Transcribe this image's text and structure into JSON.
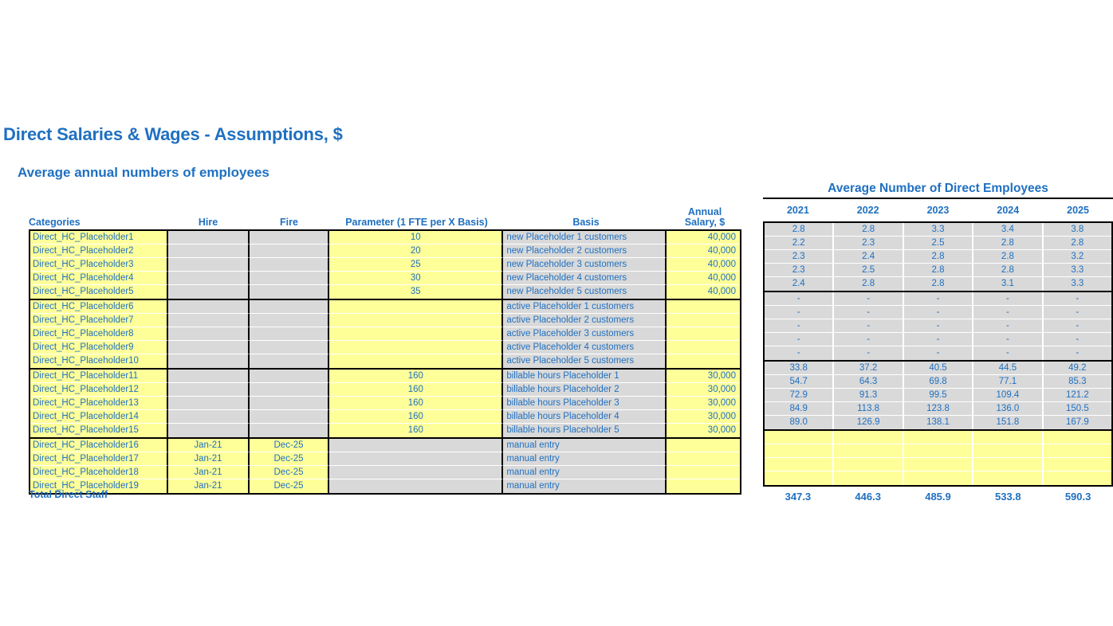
{
  "page": {
    "title": "Direct Salaries & Wages - Assumptions, $",
    "section_title": "Average annual numbers of employees",
    "total_label": "Total Direct Staff"
  },
  "colors": {
    "accent_blue": "#1F70C1",
    "input_yellow": "#FFFF99",
    "formula_gray": "#D9D9D9",
    "border_black": "#000000"
  },
  "left_table": {
    "headers": {
      "categories": "Categories",
      "hire": "Hire",
      "fire": "Fire",
      "parameter": "Parameter (1 FTE per X Basis)",
      "basis": "Basis",
      "annual_salary_line1": "Annual",
      "annual_salary_line2": "Salary, $"
    },
    "groups": [
      {
        "rows": [
          {
            "category": "Direct_HC_Placeholder1",
            "hire": "",
            "fire": "",
            "parameter": "10",
            "basis": "new Placeholder 1 customers",
            "salary": "40,000"
          },
          {
            "category": "Direct_HC_Placeholder2",
            "hire": "",
            "fire": "",
            "parameter": "20",
            "basis": "new Placeholder 2 customers",
            "salary": "40,000"
          },
          {
            "category": "Direct_HC_Placeholder3",
            "hire": "",
            "fire": "",
            "parameter": "25",
            "basis": "new Placeholder 3 customers",
            "salary": "40,000"
          },
          {
            "category": "Direct_HC_Placeholder4",
            "hire": "",
            "fire": "",
            "parameter": "30",
            "basis": "new Placeholder 4 customers",
            "salary": "40,000"
          },
          {
            "category": "Direct_HC_Placeholder5",
            "hire": "",
            "fire": "",
            "parameter": "35",
            "basis": "new Placeholder 5 customers",
            "salary": "40,000"
          }
        ]
      },
      {
        "rows": [
          {
            "category": "Direct_HC_Placeholder6",
            "hire": "",
            "fire": "",
            "parameter": "",
            "basis": "active Placeholder 1 customers",
            "salary": ""
          },
          {
            "category": "Direct_HC_Placeholder7",
            "hire": "",
            "fire": "",
            "parameter": "",
            "basis": "active Placeholder 2 customers",
            "salary": ""
          },
          {
            "category": "Direct_HC_Placeholder8",
            "hire": "",
            "fire": "",
            "parameter": "",
            "basis": "active Placeholder 3 customers",
            "salary": ""
          },
          {
            "category": "Direct_HC_Placeholder9",
            "hire": "",
            "fire": "",
            "parameter": "",
            "basis": "active Placeholder 4 customers",
            "salary": ""
          },
          {
            "category": "Direct_HC_Placeholder10",
            "hire": "",
            "fire": "",
            "parameter": "",
            "basis": "active Placeholder 5 customers",
            "salary": ""
          }
        ]
      },
      {
        "rows": [
          {
            "category": "Direct_HC_Placeholder11",
            "hire": "",
            "fire": "",
            "parameter": "160",
            "basis": "billable hours Placeholder 1",
            "salary": "30,000"
          },
          {
            "category": "Direct_HC_Placeholder12",
            "hire": "",
            "fire": "",
            "parameter": "160",
            "basis": "billable hours Placeholder 2",
            "salary": "30,000"
          },
          {
            "category": "Direct_HC_Placeholder13",
            "hire": "",
            "fire": "",
            "parameter": "160",
            "basis": "billable hours Placeholder 3",
            "salary": "30,000"
          },
          {
            "category": "Direct_HC_Placeholder14",
            "hire": "",
            "fire": "",
            "parameter": "160",
            "basis": "billable hours Placeholder 4",
            "salary": "30,000"
          },
          {
            "category": "Direct_HC_Placeholder15",
            "hire": "",
            "fire": "",
            "parameter": "160",
            "basis": "billable hours Placeholder 5",
            "salary": "30,000"
          }
        ]
      },
      {
        "rows": [
          {
            "category": "Direct_HC_Placeholder16",
            "hire": "Jan-21",
            "fire": "Dec-25",
            "parameter": "",
            "basis": "manual entry",
            "salary": ""
          },
          {
            "category": "Direct_HC_Placeholder17",
            "hire": "Jan-21",
            "fire": "Dec-25",
            "parameter": "",
            "basis": "manual entry",
            "salary": ""
          },
          {
            "category": "Direct_HC_Placeholder18",
            "hire": "Jan-21",
            "fire": "Dec-25",
            "parameter": "",
            "basis": "manual entry",
            "salary": ""
          },
          {
            "category": "Direct_HC_Placeholder19",
            "hire": "Jan-21",
            "fire": "Dec-25",
            "parameter": "",
            "basis": "manual entry",
            "salary": ""
          }
        ]
      }
    ]
  },
  "right_table": {
    "title": "Average Number of Direct Employees",
    "years": [
      "2021",
      "2022",
      "2023",
      "2024",
      "2025"
    ],
    "groups": [
      {
        "style": "gray",
        "rows": [
          [
            "2.8",
            "2.8",
            "3.3",
            "3.4",
            "3.8"
          ],
          [
            "2.2",
            "2.3",
            "2.5",
            "2.8",
            "2.8"
          ],
          [
            "2.3",
            "2.4",
            "2.8",
            "2.8",
            "3.2"
          ],
          [
            "2.3",
            "2.5",
            "2.8",
            "2.8",
            "3.3"
          ],
          [
            "2.4",
            "2.8",
            "2.8",
            "3.1",
            "3.3"
          ]
        ]
      },
      {
        "style": "gray",
        "rows": [
          [
            "-",
            "-",
            "-",
            "-",
            "-"
          ],
          [
            "-",
            "-",
            "-",
            "-",
            "-"
          ],
          [
            "-",
            "-",
            "-",
            "-",
            "-"
          ],
          [
            "-",
            "-",
            "-",
            "-",
            "-"
          ],
          [
            "-",
            "-",
            "-",
            "-",
            "-"
          ]
        ]
      },
      {
        "style": "gray",
        "rows": [
          [
            "33.8",
            "37.2",
            "40.5",
            "44.5",
            "49.2"
          ],
          [
            "54.7",
            "64.3",
            "69.8",
            "77.1",
            "85.3"
          ],
          [
            "72.9",
            "91.3",
            "99.5",
            "109.4",
            "121.2"
          ],
          [
            "84.9",
            "113.8",
            "123.8",
            "136.0",
            "150.5"
          ],
          [
            "89.0",
            "126.9",
            "138.1",
            "151.8",
            "167.9"
          ]
        ]
      },
      {
        "style": "yellow",
        "rows": [
          [
            "",
            "",
            "",
            "",
            ""
          ],
          [
            "",
            "",
            "",
            "",
            ""
          ],
          [
            "",
            "",
            "",
            "",
            ""
          ],
          [
            "",
            "",
            "",
            "",
            ""
          ]
        ]
      }
    ],
    "totals": [
      "347.3",
      "446.3",
      "485.9",
      "533.8",
      "590.3"
    ]
  }
}
